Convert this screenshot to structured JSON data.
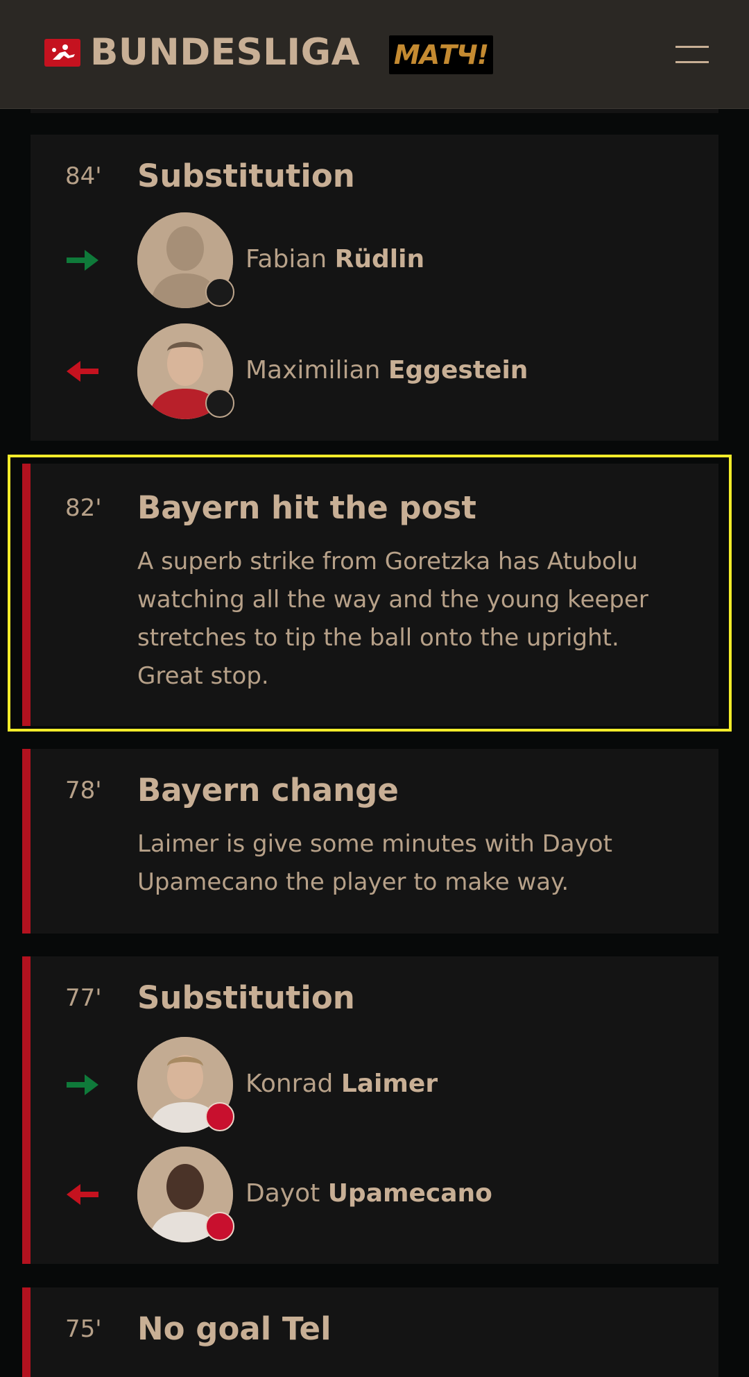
{
  "header": {
    "brand": "BUNDESLIGA",
    "partner": "МАТЧ!",
    "icons": [
      "bundesliga-logo-icon",
      "menu-icon"
    ]
  },
  "events": [
    {
      "minute": "84'",
      "title": "Substitution",
      "type": "substitution",
      "in": {
        "first": "Fabian",
        "last": "Rüdlin",
        "club": "freiburg"
      },
      "out": {
        "first": "Maximilian",
        "last": "Eggestein",
        "club": "freiburg"
      }
    },
    {
      "minute": "82'",
      "title": "Bayern hit the post",
      "type": "commentary",
      "text": "A superb strike from Goretzka has Atubolu watching all the way and the young keeper stretches to tip the ball onto the upright. Great stop."
    },
    {
      "minute": "78'",
      "title": "Bayern change",
      "type": "commentary",
      "text": "Laimer is give some minutes with Dayot Upamecano the player to make way."
    },
    {
      "minute": "77'",
      "title": "Substitution",
      "type": "substitution",
      "in": {
        "first": "Konrad",
        "last": "Laimer",
        "club": "bayern"
      },
      "out": {
        "first": "Dayot",
        "last": "Upamecano",
        "club": "bayern"
      }
    },
    {
      "minute": "75'",
      "title": "No goal Tel",
      "type": "commentary"
    }
  ],
  "colors": {
    "background": "#070909",
    "card": "#141414",
    "accent_bar": "#b3121f",
    "text": "#c8af95",
    "arrow_in": "#0f7a3a",
    "arrow_out": "#c5121f",
    "highlight": "#f2ec2a"
  }
}
